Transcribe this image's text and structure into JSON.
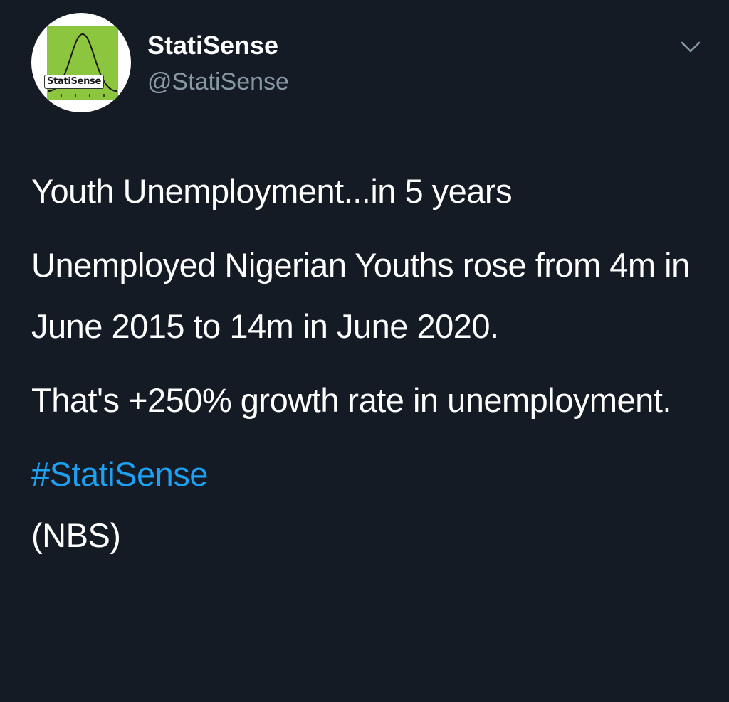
{
  "profile": {
    "display_name": "StatiSense",
    "handle": "@StatiSense",
    "avatar_text": "StatiSense"
  },
  "menu": {
    "icon": "chevron-down-icon"
  },
  "tweet": {
    "paragraphs": [
      "Youth Unemployment...in 5 years",
      "Unemployed Nigerian Youths rose from 4m in June 2015 to 14m in June 2020.",
      "That's +250% growth rate in unemployment."
    ],
    "hashtag": "#StatiSense",
    "source": "(NBS)"
  },
  "colors": {
    "background": "#141b25",
    "text": "#ffffff",
    "muted": "#8899a6",
    "link": "#1da1f2",
    "avatar_green": "#8cc63f"
  }
}
